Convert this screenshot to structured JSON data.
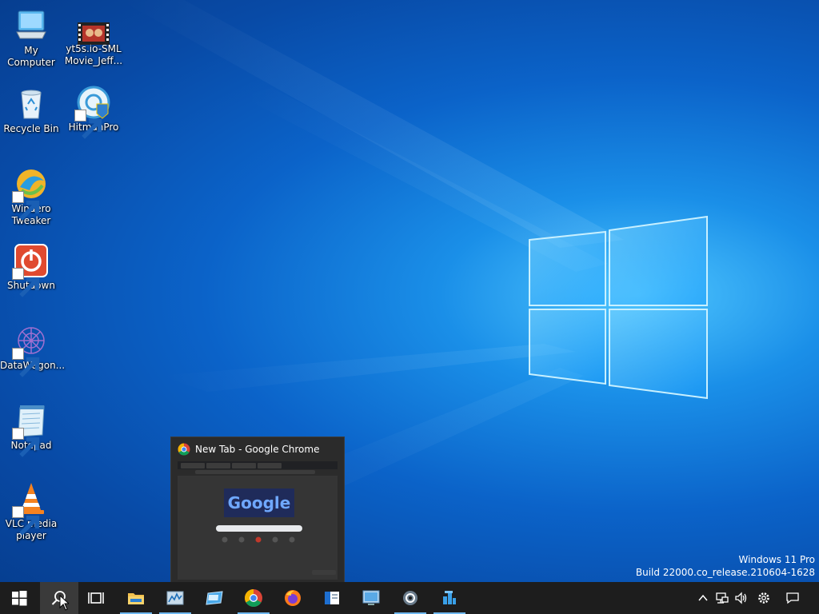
{
  "desktop": {
    "icons": [
      {
        "label": "My Computer"
      },
      {
        "label": "yt5s.io-SML Movie_Jeff..."
      },
      {
        "label": "Recycle Bin"
      },
      {
        "label": "HitmanPro"
      },
      {
        "label": "Winaero Tweaker"
      },
      {
        "label": "Shutdown"
      },
      {
        "label": "DataWagon..."
      },
      {
        "label": "Notepad"
      },
      {
        "label": "VLC media player"
      }
    ]
  },
  "watermark": {
    "line1": "Windows 11 Pro",
    "line2": "Build 22000.co_release.210604-1628"
  },
  "thumbnail": {
    "title": "New Tab - Google Chrome",
    "preview_logo_text": "Google"
  },
  "taskbar": {
    "buttons": [
      "start-icon",
      "search-icon",
      "task-view-icon",
      "file-explorer-icon",
      "resource-monitor-icon",
      "app-window-icon",
      "chrome-icon",
      "firefox-icon",
      "app-blue-icon",
      "remote-desktop-icon",
      "settings-icon",
      "blue-app-icon"
    ],
    "tray": [
      "chevron-up-icon",
      "network-icon",
      "volume-icon",
      "gear-icon",
      "notification-icon"
    ]
  },
  "colors": {
    "taskbar": "#1d1d1d",
    "accent": "#6fb8f0",
    "wallpaper": "#0b63c9"
  }
}
